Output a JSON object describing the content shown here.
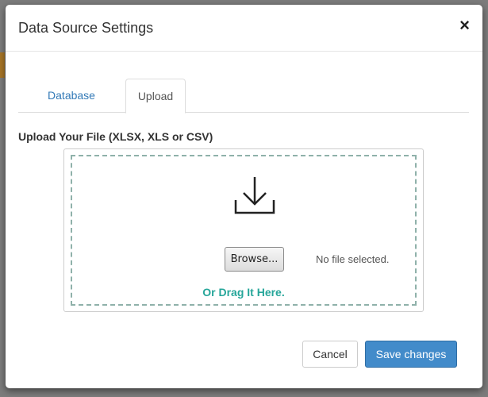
{
  "modal": {
    "title": "Data Source Settings",
    "close_label": "×"
  },
  "tabs": [
    {
      "label": "Database",
      "active": false
    },
    {
      "label": "Upload",
      "active": true
    }
  ],
  "upload": {
    "label": "Upload Your File (XLSX, XLS or CSV)",
    "browse_label": "Browse...",
    "file_status": "No file selected.",
    "drag_hint": "Or Drag It Here.",
    "icon": "download-icon"
  },
  "footer": {
    "cancel_label": "Cancel",
    "save_label": "Save changes"
  },
  "colors": {
    "accent": "#428bca",
    "link": "#337ab7",
    "drag_hint": "#26a69a",
    "dropzone_border": "#8fb1aa"
  }
}
